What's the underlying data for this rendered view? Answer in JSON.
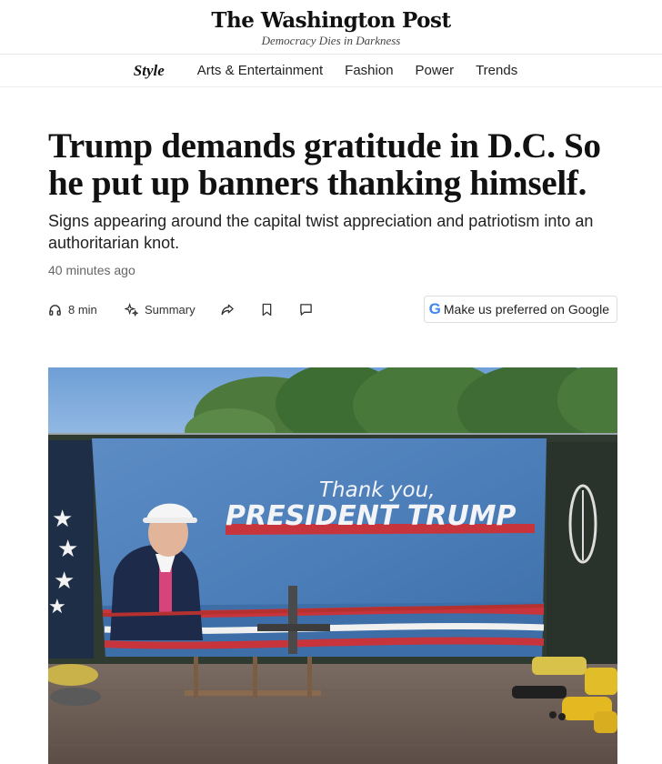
{
  "masthead": {
    "logo": "The Washington Post",
    "tagline": "Democracy Dies in Darkness"
  },
  "nav": {
    "section": "Style",
    "items": [
      "Arts & Entertainment",
      "Fashion",
      "Power",
      "Trends"
    ]
  },
  "article": {
    "headline_line1": "Trump demands gratitude in D.C. So",
    "headline_line2": "he put up banners thanking himself.",
    "dek": "Signs appearing around the capital twist appreciation and patriotism into an authoritarian knot.",
    "timestamp": "40 minutes ago"
  },
  "toolbar": {
    "listen_label": "8 min",
    "summary_label": "Summary",
    "icons": [
      "headphones-icon",
      "sparkle-icon",
      "share-icon",
      "bookmark-icon",
      "comment-icon"
    ],
    "google_button_label": "Make us preferred on Google",
    "google_logo": "G"
  },
  "photo": {
    "banner_line1": "Thank you,",
    "banner_line2": "PRESIDENT TRUMP"
  },
  "colors": {
    "google_blue": "#4285f4",
    "sky": "#7aa6d8",
    "banner_blue": "#4f7fb8",
    "banner_red": "#c8343b",
    "fence_green": "#2f3a30"
  }
}
